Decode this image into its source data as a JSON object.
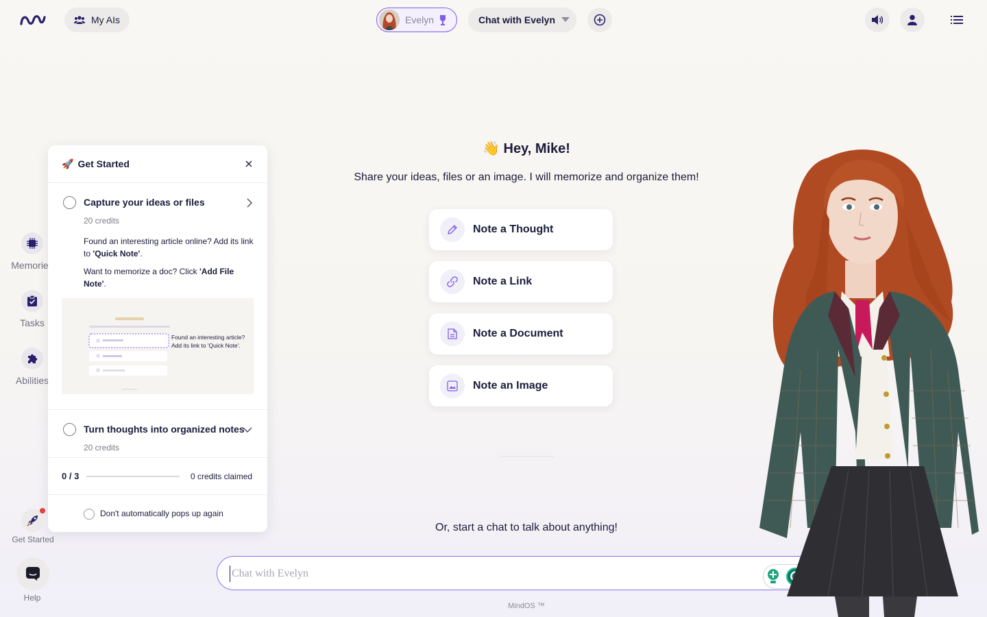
{
  "topbar": {
    "my_ais_label": "My AIs",
    "ai_name": "Evelyn",
    "chat_mode_label": "Chat with Evelyn"
  },
  "rail": {
    "items": [
      {
        "label": "Memories",
        "icon": "chip-icon"
      },
      {
        "label": "Tasks",
        "icon": "clipboard-icon"
      },
      {
        "label": "Abilities",
        "icon": "puzzle-icon"
      }
    ],
    "get_started_label": "Get Started",
    "help_label": "Help"
  },
  "get_started": {
    "title": "Get Started",
    "steps": [
      {
        "title": "Capture your ideas or files",
        "credits": "20 credits",
        "desc_1_prefix": "Found an interesting article online? Add its link to ",
        "desc_1_bold": "'Quick Note'",
        "desc_1_suffix": ".",
        "desc_2_prefix": "Want to memorize a doc? Click ",
        "desc_2_bold": "'Add File Note'",
        "desc_2_suffix": ".",
        "preview_caption": "Found an interesting article? Add its link to 'Quick Note'."
      },
      {
        "title": "Turn thoughts into organized notes",
        "credits": "20 credits"
      }
    ],
    "progress_text": "0 / 3",
    "progress_fraction": 0,
    "credits_claimed": "0 credits claimed",
    "dont_popup_label": "Don't automatically pops up again"
  },
  "main": {
    "greeting": "👋 Hey, Mike!",
    "subtitle": "Share your ideas, files or an image. I will memorize and organize them!",
    "actions": [
      {
        "label": "Note a Thought",
        "icon": "pencil-icon"
      },
      {
        "label": "Note a Link",
        "icon": "link-icon"
      },
      {
        "label": "Note a Document",
        "icon": "document-icon"
      },
      {
        "label": "Note an Image",
        "icon": "image-icon"
      }
    ],
    "start_chat_text": "Or, start a chat to talk about anything!"
  },
  "chat": {
    "placeholder": "Chat with Evelyn",
    "value": ""
  },
  "footer": {
    "brand": "MindOS ™"
  },
  "colors": {
    "accent": "#7e5ee6",
    "text": "#1b1b3a",
    "background": "#f8f6f3",
    "notification": "#e5403b"
  }
}
